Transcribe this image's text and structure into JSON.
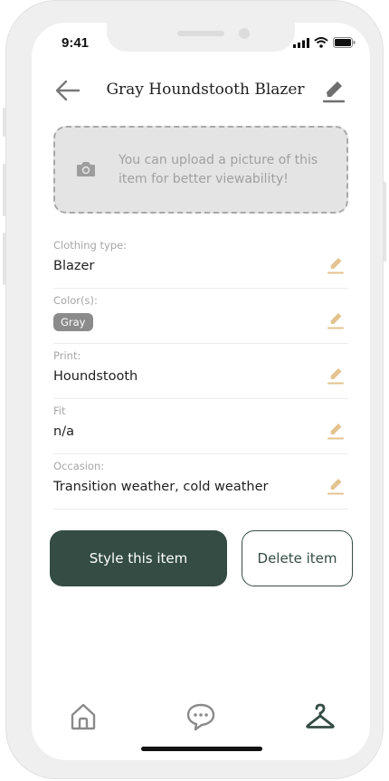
{
  "status_bar": {
    "time": "9:41"
  },
  "header": {
    "title": "Gray Houndstooth Blazer",
    "back_icon": "arrow-left-icon",
    "edit_icon": "pencil-icon"
  },
  "upload": {
    "hint": "You can upload a picture of this item for better viewability!",
    "icon": "camera-icon"
  },
  "fields": [
    {
      "label": "Clothing type:",
      "value": "Blazer"
    },
    {
      "label": "Color(s):",
      "chip": "Gray"
    },
    {
      "label": "Print:",
      "value": "Houndstooth"
    },
    {
      "label": "Fit",
      "value": "n/a"
    },
    {
      "label": "Occasion:",
      "value": "Transition weather, cold weather"
    }
  ],
  "actions": {
    "style_label": "Style this item",
    "delete_label": "Delete item"
  },
  "tabbar": {
    "items": [
      "home-icon",
      "chat-bubble-icon",
      "hanger-icon"
    ],
    "active": "hanger-icon"
  },
  "colors": {
    "primary": "#344c44",
    "edit_accent": "#e3c38f",
    "placeholder_bg": "#e4e4e4",
    "chip_bg": "#8b8b8b"
  }
}
